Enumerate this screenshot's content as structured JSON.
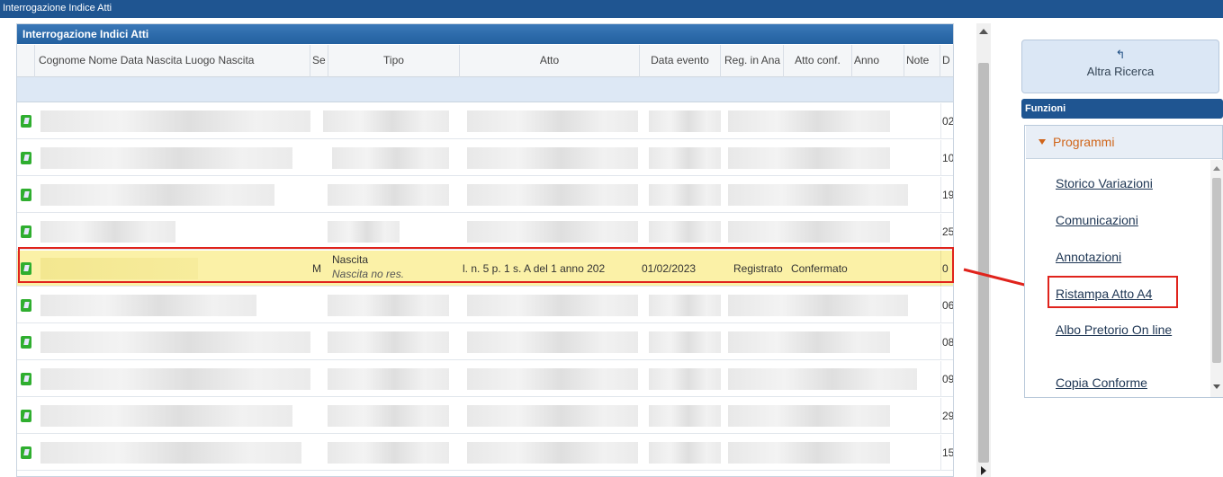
{
  "window": {
    "title": "Interrogazione Indice Atti"
  },
  "grid": {
    "caption": "Interrogazione Indici Atti",
    "columns": [
      "Cognome Nome Data Nascita Luogo Nascita",
      "Se",
      "Tipo",
      "Atto",
      "Data evento",
      "Reg. in Ana",
      "Atto conf.",
      "Anno",
      "Note",
      "D"
    ],
    "date_fragments": [
      "02",
      "10",
      "19",
      "25",
      "0",
      "06",
      "08",
      "09",
      "29",
      "15"
    ],
    "selected_row": {
      "sex": "M",
      "tipo": "Nascita",
      "tipo_sub": "Nascita no res.",
      "atto": "l. n. 5 p. 1 s. A del 1 anno 202",
      "data_evento": "01/02/2023",
      "reg_anagrafe": "Registrato",
      "atto_conf": "Confermato"
    }
  },
  "sidebar": {
    "altra_ricerca": "Altra Ricerca",
    "funzioni_header": "Funzioni",
    "programmi_label": "Programmi",
    "links": [
      "Storico Variazioni",
      "Comunicazioni",
      "Annotazioni",
      "Ristampa Atto A4",
      "Albo Pretorio On line",
      "Copia Conforme"
    ]
  },
  "colors": {
    "title_bar": "#1f5591",
    "selected_row": "#fbf1a7",
    "highlight_border": "#e0231c",
    "programmi_text": "#d0651a"
  }
}
